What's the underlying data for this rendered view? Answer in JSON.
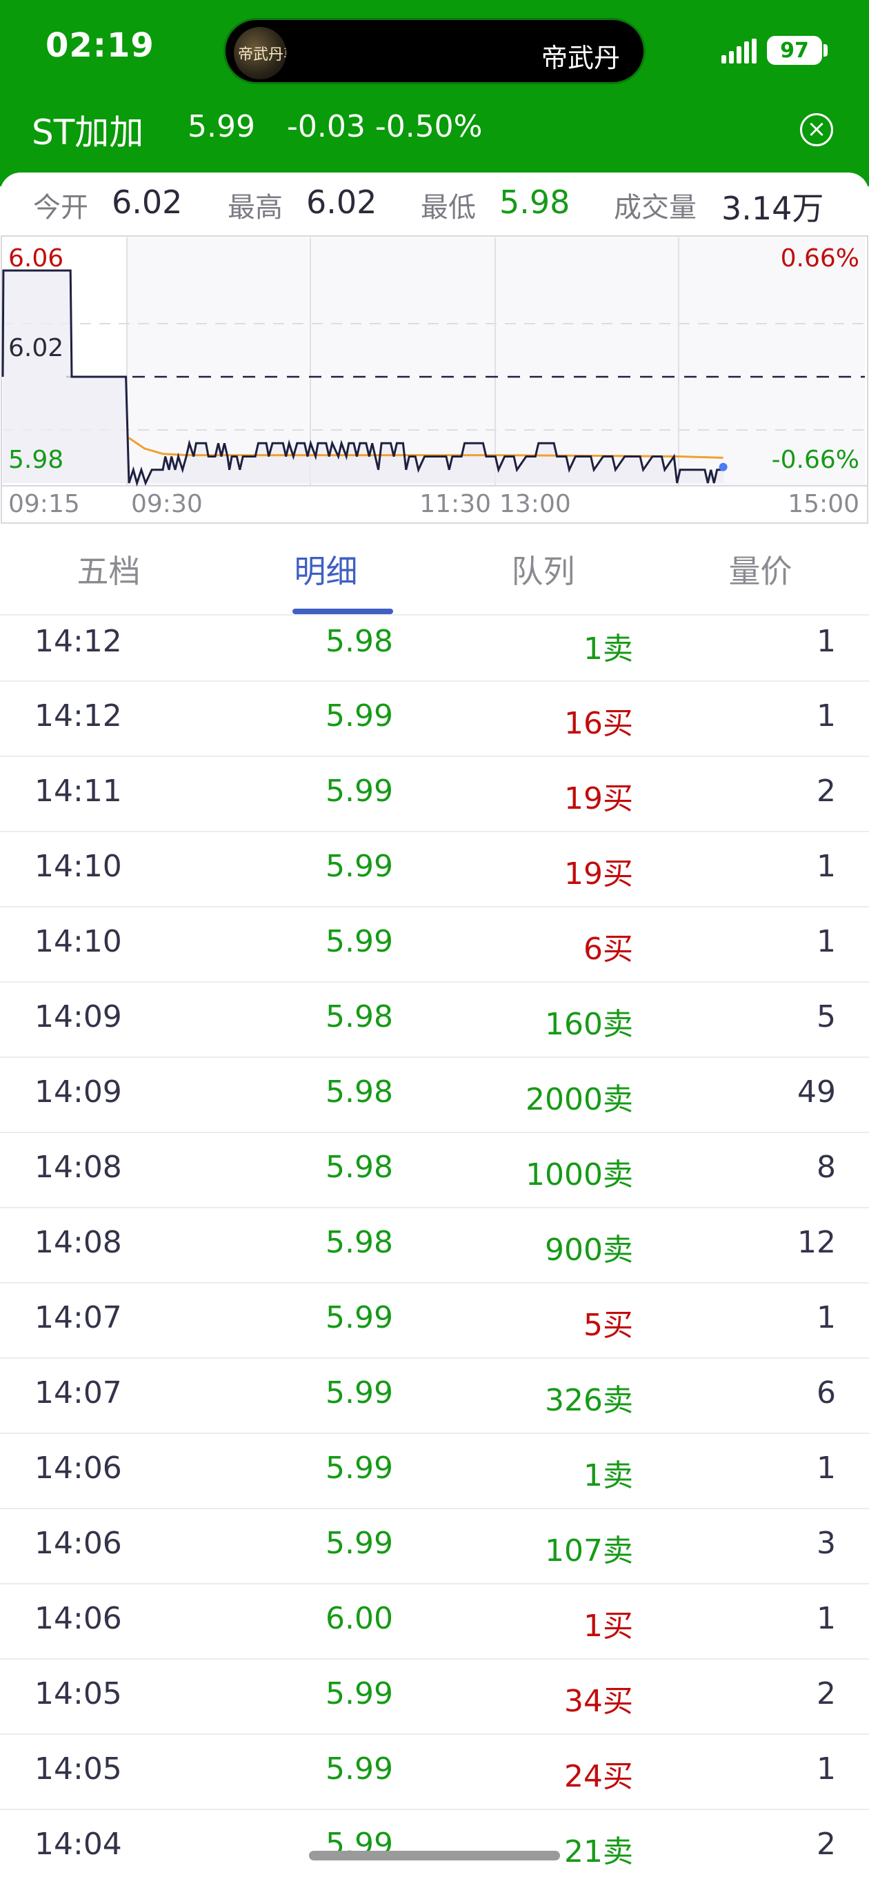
{
  "status_bar": {
    "time": "02:19",
    "island_label": "帝武丹",
    "island_art_text": "帝武丹尊",
    "battery": "97"
  },
  "stock": {
    "name": "ST加加",
    "price": "5.99",
    "change": "-0.03 -0.50%",
    "close_icon": "close-circle-icon"
  },
  "stats": [
    {
      "label": "今开",
      "value": "6.02",
      "color": "#2a2a3a"
    },
    {
      "label": "最高",
      "value": "6.02",
      "color": "#2a2a3a"
    },
    {
      "label": "最低",
      "value": "5.98",
      "color": "#169a16"
    },
    {
      "label": "成交量",
      "value": "3.14万",
      "color": "#2a2a3a"
    }
  ],
  "chart_data": {
    "type": "line",
    "y_labels_left": [
      "6.06",
      "6.02",
      "5.98"
    ],
    "y_labels_right": [
      "0.66%",
      "-0.66%"
    ],
    "x_labels": [
      "09:15",
      "09:30",
      "11:30",
      "13:00",
      "15:00"
    ],
    "ylim": [
      5.98,
      6.06
    ],
    "reference_price": 6.02,
    "colors": {
      "price": "#1e2040",
      "average": "#f0a030",
      "up": "#c20c0c",
      "down": "#169a16",
      "current_dot": "#4b7cf5"
    },
    "series": [
      {
        "role": "price",
        "points": [
          [
            0,
            6.02
          ],
          [
            0.01,
            6.06
          ],
          [
            1.1,
            6.06
          ],
          [
            1.12,
            6.02
          ],
          [
            2.0,
            6.02
          ],
          [
            2.05,
            5.98
          ],
          [
            2.12,
            5.985
          ],
          [
            2.18,
            5.98
          ],
          [
            2.25,
            5.985
          ],
          [
            2.32,
            5.98
          ],
          [
            2.42,
            5.985
          ],
          [
            2.6,
            5.985
          ],
          [
            2.64,
            5.99
          ],
          [
            2.7,
            5.985
          ],
          [
            2.74,
            5.99
          ],
          [
            2.8,
            5.985
          ],
          [
            2.85,
            5.99
          ],
          [
            2.92,
            5.985
          ],
          [
            2.98,
            5.99
          ],
          [
            3.03,
            5.995
          ],
          [
            3.1,
            5.99
          ],
          [
            3.14,
            5.995
          ],
          [
            3.3,
            5.995
          ],
          [
            3.34,
            5.99
          ],
          [
            3.45,
            5.99
          ],
          [
            3.5,
            5.995
          ],
          [
            3.55,
            5.99
          ],
          [
            3.6,
            5.995
          ],
          [
            3.65,
            5.99
          ],
          [
            3.68,
            5.985
          ],
          [
            3.72,
            5.99
          ],
          [
            3.8,
            5.99
          ],
          [
            3.85,
            5.985
          ],
          [
            3.9,
            5.99
          ],
          [
            4.1,
            5.99
          ],
          [
            4.15,
            5.995
          ],
          [
            4.28,
            5.995
          ],
          [
            4.32,
            5.99
          ],
          [
            4.38,
            5.995
          ],
          [
            4.55,
            5.995
          ],
          [
            4.6,
            5.99
          ],
          [
            4.65,
            5.995
          ],
          [
            4.72,
            5.99
          ],
          [
            4.78,
            5.995
          ],
          [
            4.9,
            5.995
          ],
          [
            4.95,
            5.99
          ],
          [
            5.0,
            5.995
          ],
          [
            5.08,
            5.99
          ],
          [
            5.12,
            5.995
          ],
          [
            5.25,
            5.995
          ],
          [
            5.3,
            5.99
          ],
          [
            5.35,
            5.995
          ],
          [
            5.45,
            5.99
          ],
          [
            5.5,
            5.995
          ],
          [
            5.58,
            5.99
          ],
          [
            5.62,
            5.995
          ],
          [
            5.7,
            5.995
          ],
          [
            5.75,
            5.99
          ],
          [
            5.8,
            5.995
          ],
          [
            5.9,
            5.995
          ],
          [
            5.95,
            5.99
          ],
          [
            6.0,
            5.995
          ],
          [
            6.1,
            5.985
          ],
          [
            6.15,
            5.995
          ],
          [
            6.3,
            5.995
          ],
          [
            6.35,
            5.99
          ],
          [
            6.4,
            5.995
          ],
          [
            6.5,
            5.995
          ],
          [
            6.55,
            5.985
          ],
          [
            6.6,
            5.99
          ],
          [
            6.7,
            5.99
          ],
          [
            6.75,
            5.985
          ],
          [
            6.85,
            5.99
          ],
          [
            7.2,
            5.99
          ],
          [
            7.25,
            5.985
          ],
          [
            7.3,
            5.99
          ],
          [
            7.45,
            5.99
          ],
          [
            7.5,
            5.995
          ],
          [
            7.8,
            5.995
          ],
          [
            7.85,
            5.99
          ],
          [
            8.0,
            5.99
          ],
          [
            8.05,
            5.985
          ],
          [
            8.15,
            5.99
          ],
          [
            8.3,
            5.99
          ],
          [
            8.35,
            5.985
          ],
          [
            8.5,
            5.99
          ],
          [
            8.65,
            5.99
          ],
          [
            8.7,
            5.995
          ],
          [
            8.95,
            5.995
          ],
          [
            9.0,
            5.99
          ],
          [
            9.15,
            5.99
          ],
          [
            9.2,
            5.985
          ],
          [
            9.3,
            5.99
          ],
          [
            9.55,
            5.99
          ],
          [
            9.6,
            5.985
          ],
          [
            9.75,
            5.99
          ],
          [
            9.9,
            5.99
          ],
          [
            9.95,
            5.985
          ],
          [
            10.1,
            5.99
          ],
          [
            10.35,
            5.99
          ],
          [
            10.4,
            5.985
          ],
          [
            10.55,
            5.99
          ],
          [
            10.7,
            5.99
          ],
          [
            10.75,
            5.985
          ],
          [
            10.9,
            5.99
          ],
          [
            10.95,
            5.98
          ],
          [
            11.0,
            5.985
          ],
          [
            11.2,
            5.985
          ],
          [
            11.4,
            5.985
          ],
          [
            11.45,
            5.98
          ],
          [
            11.5,
            5.985
          ],
          [
            11.55,
            5.98
          ],
          [
            11.6,
            5.985
          ],
          [
            11.7,
            5.985
          ]
        ]
      },
      {
        "role": "average",
        "points": [
          [
            2.05,
            5.997
          ],
          [
            2.3,
            5.993
          ],
          [
            2.6,
            5.991
          ],
          [
            3.0,
            5.9905
          ],
          [
            4.0,
            5.9905
          ],
          [
            6.0,
            5.9905
          ],
          [
            8.0,
            5.9905
          ],
          [
            10.0,
            5.9902
          ],
          [
            11.0,
            5.99
          ],
          [
            11.7,
            5.9895
          ]
        ]
      }
    ]
  },
  "tabs": [
    {
      "label": "五档",
      "active": false
    },
    {
      "label": "明细",
      "active": true
    },
    {
      "label": "队列",
      "active": false
    },
    {
      "label": "量价",
      "active": false
    }
  ],
  "rows": [
    {
      "time": "14:12",
      "price": "5.98",
      "vol": "1卖",
      "side": "sell",
      "count": "1"
    },
    {
      "time": "14:12",
      "price": "5.99",
      "vol": "16买",
      "side": "buy",
      "count": "1"
    },
    {
      "time": "14:11",
      "price": "5.99",
      "vol": "19买",
      "side": "buy",
      "count": "2"
    },
    {
      "time": "14:10",
      "price": "5.99",
      "vol": "19买",
      "side": "buy",
      "count": "1"
    },
    {
      "time": "14:10",
      "price": "5.99",
      "vol": "6买",
      "side": "buy",
      "count": "1"
    },
    {
      "time": "14:09",
      "price": "5.98",
      "vol": "160卖",
      "side": "sell",
      "count": "5"
    },
    {
      "time": "14:09",
      "price": "5.98",
      "vol": "2000卖",
      "side": "sell",
      "count": "49"
    },
    {
      "time": "14:08",
      "price": "5.98",
      "vol": "1000卖",
      "side": "sell",
      "count": "8"
    },
    {
      "time": "14:08",
      "price": "5.98",
      "vol": "900卖",
      "side": "sell",
      "count": "12"
    },
    {
      "time": "14:07",
      "price": "5.99",
      "vol": "5买",
      "side": "buy",
      "count": "1"
    },
    {
      "time": "14:07",
      "price": "5.99",
      "vol": "326卖",
      "side": "sell",
      "count": "6"
    },
    {
      "time": "14:06",
      "price": "5.99",
      "vol": "1卖",
      "side": "sell",
      "count": "1"
    },
    {
      "time": "14:06",
      "price": "5.99",
      "vol": "107卖",
      "side": "sell",
      "count": "3"
    },
    {
      "time": "14:06",
      "price": "6.00",
      "vol": "1买",
      "side": "buy",
      "count": "1"
    },
    {
      "time": "14:05",
      "price": "5.99",
      "vol": "34买",
      "side": "buy",
      "count": "2"
    },
    {
      "time": "14:05",
      "price": "5.99",
      "vol": "24买",
      "side": "buy",
      "count": "1"
    },
    {
      "time": "14:04",
      "price": "5.99",
      "vol": "21卖",
      "side": "sell",
      "count": "2"
    }
  ]
}
